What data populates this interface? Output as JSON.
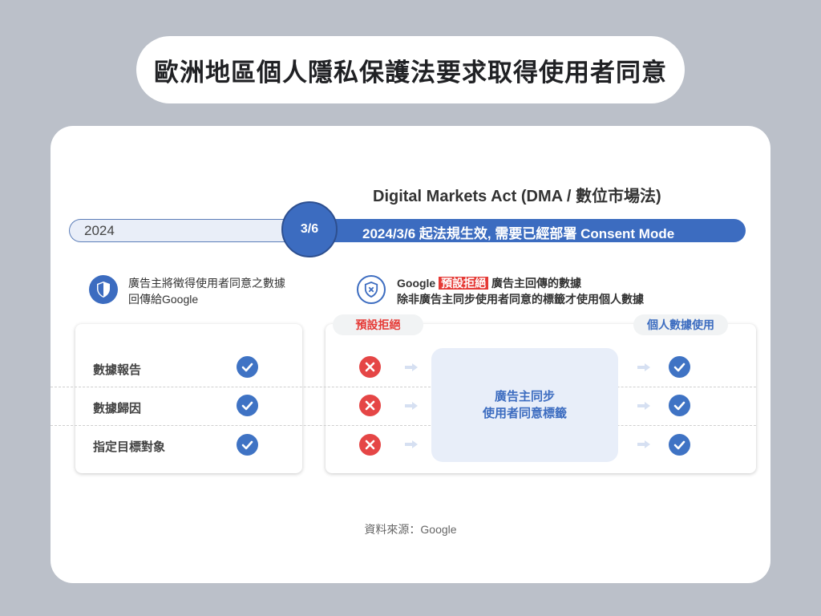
{
  "title": "歐洲地區個人隱私保護法要求取得使用者同意",
  "dma_title": "Digital Markets Act (DMA / 數位市場法)",
  "timeline": {
    "year": "2024",
    "date": "3/6",
    "effective_text": "2024/3/6 起法規生效, 需要已經部署 Consent Mode"
  },
  "left_desc": {
    "line1": "廣告主將徵得使用者同意之數據",
    "line2": "回傳給Google"
  },
  "right_desc": {
    "prefix": "Google ",
    "tag": "預設拒絕",
    "line1_rest": " 廣告主回傳的數據",
    "line2": "除非廣告主同步使用者同意的標籤才使用個人數據"
  },
  "chips": {
    "default_reject": "預設拒絕",
    "personal_data_use": "個人數據使用"
  },
  "rows": [
    {
      "label": "數據報告"
    },
    {
      "label": "數據歸因"
    },
    {
      "label": "指定目標對象"
    }
  ],
  "sync_box": {
    "line1": "廣告主同步",
    "line2": "使用者同意標籤"
  },
  "source": "資料來源：Google",
  "icons": {
    "left": "shield-check-icon",
    "right": "shield-x-icon",
    "check": "check-circle-icon",
    "cross": "x-circle-icon",
    "arrow": "arrow-right-icon"
  },
  "colors": {
    "primary_blue": "#3c6cc0",
    "reject_red": "#e53935",
    "background": "#bbc0c9"
  }
}
